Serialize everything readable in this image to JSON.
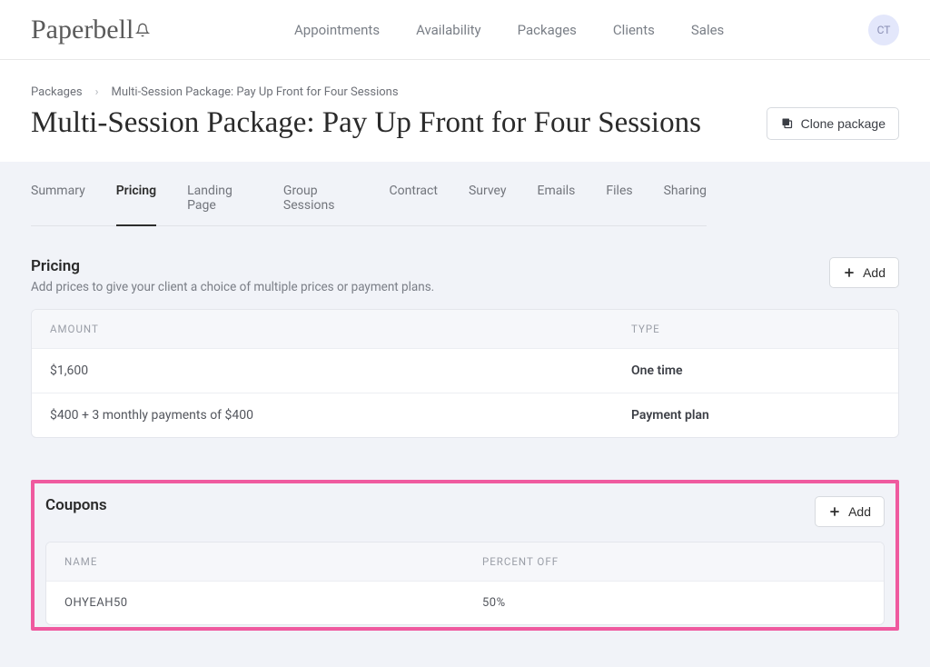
{
  "brand": "Paperbell",
  "nav": {
    "items": [
      "Appointments",
      "Availability",
      "Packages",
      "Clients",
      "Sales"
    ]
  },
  "avatar": "CT",
  "breadcrumb": {
    "root": "Packages",
    "current": "Multi-Session Package: Pay Up Front for Four Sessions"
  },
  "page_title": "Multi-Session Package: Pay Up Front for Four Sessions",
  "clone_label": "Clone package",
  "tabs": [
    "Summary",
    "Pricing",
    "Landing Page",
    "Group Sessions",
    "Contract",
    "Survey",
    "Emails",
    "Files",
    "Sharing"
  ],
  "active_tab": "Pricing",
  "pricing": {
    "title": "Pricing",
    "subtitle": "Add prices to give your client a choice of multiple prices or payment plans.",
    "add_label": "Add",
    "headers": {
      "amount": "AMOUNT",
      "type": "TYPE"
    },
    "rows": [
      {
        "amount": "$1,600",
        "type": "One time"
      },
      {
        "amount": "$400 + 3 monthly payments of $400",
        "type": "Payment plan"
      }
    ]
  },
  "coupons": {
    "title": "Coupons",
    "add_label": "Add",
    "headers": {
      "name": "NAME",
      "percent": "PERCENT OFF"
    },
    "rows": [
      {
        "name": "OHYEAH50",
        "percent": "50%"
      }
    ]
  }
}
